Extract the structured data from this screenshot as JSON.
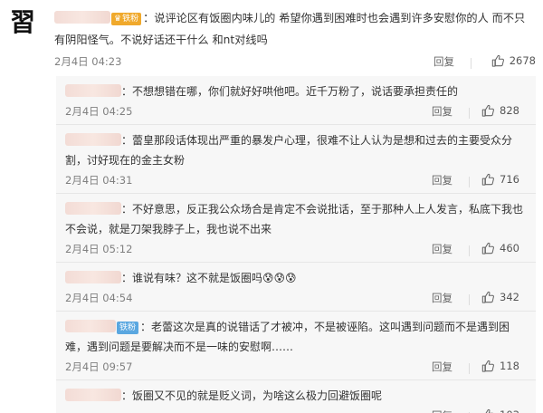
{
  "main": {
    "avatar_glyph": "習",
    "badge_label": "铁粉",
    "text": "：说评论区有饭圈内味儿的 希望你遇到困难时也会遇到许多安慰你的人 而不只有阴阳怪气。不说好话还干什么 和nt对线吗",
    "time": "2月4日 04:23",
    "reply_label": "回复",
    "likes": "2678"
  },
  "replies": [
    {
      "badge": "",
      "text": "：不想想错在哪，你们就好好哄他吧。近千万粉了，说话要承担责任的",
      "time": "2月4日 04:25",
      "reply_label": "回复",
      "likes": "828"
    },
    {
      "badge": "",
      "text": "：蕾皇那段话体现出严重的暴发户心理，很难不让人认为是想和过去的主要受众分割，讨好现在的金主女粉",
      "time": "2月4日 04:31",
      "reply_label": "回复",
      "likes": "716"
    },
    {
      "badge": "",
      "text": "：不好意思，反正我公众场合是肯定不会说批话，至于那种人上人发言，私底下我也不会说，就是刀架我脖子上，我也说不出来",
      "time": "2月4日 05:12",
      "reply_label": "回复",
      "likes": "460"
    },
    {
      "badge": "",
      "text": "：谁说有味？这不就是饭圈吗😰😰😰",
      "time": "2月4日 04:54",
      "reply_label": "回复",
      "likes": "342"
    },
    {
      "badge": "铁粉",
      "text": "：老蕾这次是真的说错话了才被冲，不是被诬陷。这叫遇到问题而不是遇到困难，遇到问题是要解决而不是一味的安慰啊……",
      "time": "2月4日 09:57",
      "reply_label": "回复",
      "likes": "118"
    },
    {
      "badge": "",
      "text": "：饭圈又不见的就是贬义词，为啥这么极力回避饭圈呢",
      "time": "",
      "reply_label": "回复",
      "likes": "103"
    }
  ]
}
